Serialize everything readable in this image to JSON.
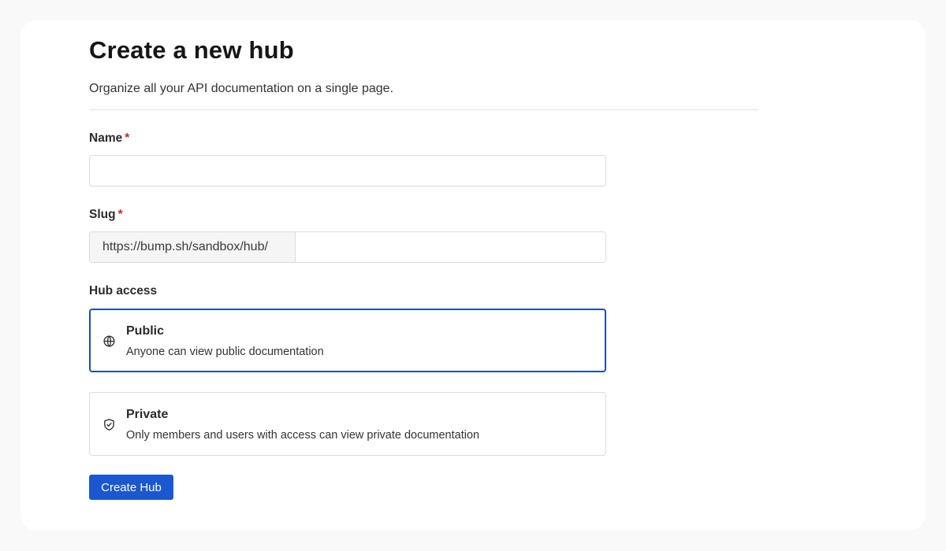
{
  "page": {
    "title": "Create a new hub",
    "subtitle": "Organize all your API documentation on a single page."
  },
  "form": {
    "name": {
      "label": "Name",
      "required_mark": "*",
      "value": "",
      "placeholder": ""
    },
    "slug": {
      "label": "Slug",
      "required_mark": "*",
      "prefix": "https://bump.sh/sandbox/hub/",
      "value": "",
      "placeholder": ""
    },
    "access": {
      "label": "Hub access",
      "selected": "public",
      "options": [
        {
          "id": "public",
          "title": "Public",
          "description": "Anyone can view public documentation",
          "icon": "globe-icon"
        },
        {
          "id": "private",
          "title": "Private",
          "description": "Only members and users with access can view private documentation",
          "icon": "shield-check-icon"
        }
      ]
    },
    "submit_label": "Create Hub"
  },
  "colors": {
    "accent": "#1a57d0",
    "selected_border": "#1b4fb7",
    "required": "#d0262c"
  }
}
